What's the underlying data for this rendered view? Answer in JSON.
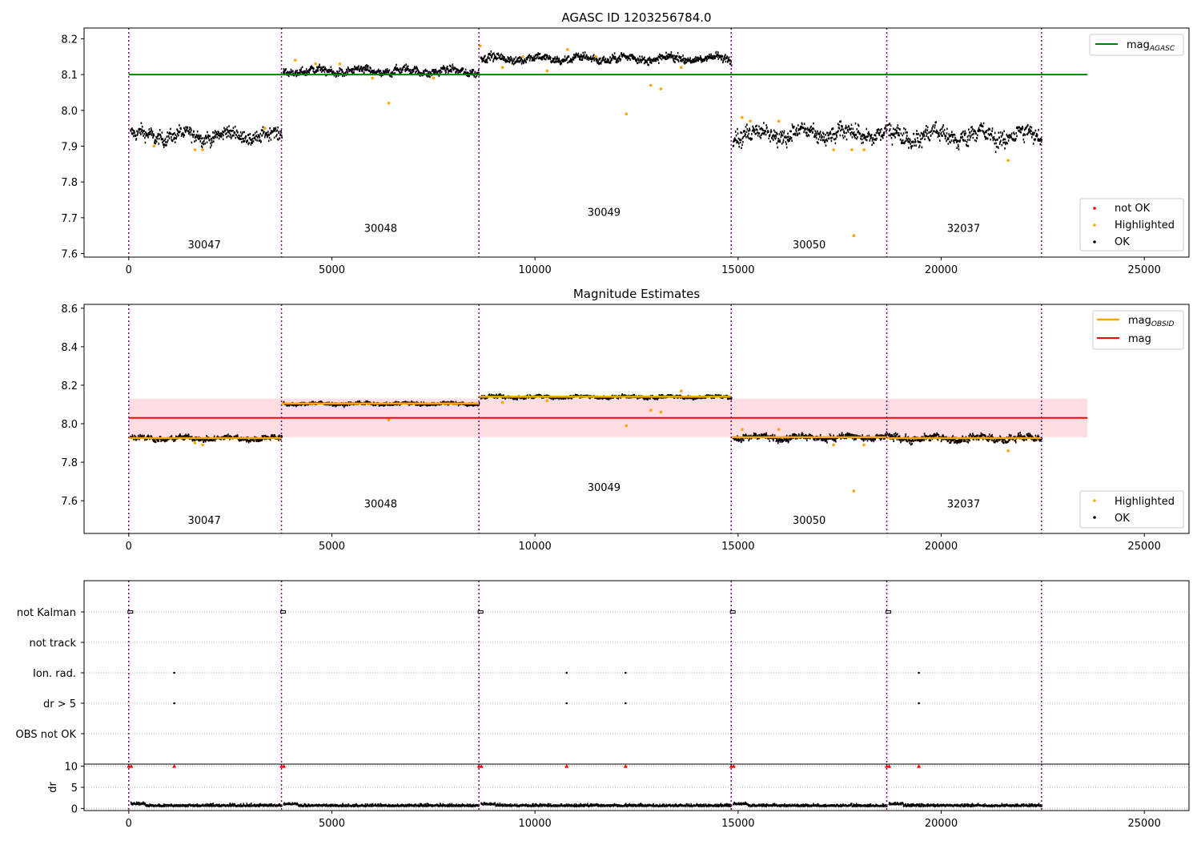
{
  "colors": {
    "ok": "#000000",
    "highlighted": "#ffa500",
    "not_ok": "#ff0000",
    "mag_agasc": "#008000",
    "mag": "#ff0000",
    "mag_band": "#ffb6c1",
    "obs_boundary": "#800080",
    "grid": "#b0b0b0"
  },
  "chart_data": [
    {
      "type": "scatter",
      "title": "AGASC ID 1203256784.0",
      "xlim": [
        -1100,
        26100
      ],
      "ylim": [
        7.59,
        8.23
      ],
      "xticks": [
        0,
        5000,
        10000,
        15000,
        20000,
        25000
      ],
      "yticks": [
        7.6,
        7.7,
        7.8,
        7.9,
        8.0,
        8.1,
        8.2
      ],
      "obs_boundaries": [
        0,
        3760,
        8620,
        14830,
        18660,
        22470
      ],
      "observations": [
        {
          "label": "30047",
          "x_start": 0,
          "x_end": 3760,
          "mag": 7.93,
          "spread": 0.02,
          "label_x": 1860,
          "label_y": 7.615
        },
        {
          "label": "30048",
          "x_start": 3760,
          "x_end": 8620,
          "mag": 8.11,
          "spread": 0.012,
          "label_x": 6200,
          "label_y": 7.66
        },
        {
          "label": "30049",
          "x_start": 8620,
          "x_end": 14830,
          "mag": 8.145,
          "spread": 0.012,
          "label_x": 11700,
          "label_y": 7.705
        },
        {
          "label": "30050",
          "x_start": 14830,
          "x_end": 18660,
          "mag": 7.935,
          "spread": 0.025,
          "label_x": 16750,
          "label_y": 7.615
        },
        {
          "label": "32037",
          "x_start": 18660,
          "x_end": 22470,
          "mag": 7.93,
          "spread": 0.027,
          "label_x": 20550,
          "label_y": 7.66
        }
      ],
      "highlighted": [
        [
          620,
          7.9
        ],
        [
          1630,
          7.89
        ],
        [
          1820,
          7.89
        ],
        [
          3350,
          7.95
        ],
        [
          4600,
          8.13
        ],
        [
          5200,
          8.13
        ],
        [
          6400,
          8.02
        ],
        [
          6000,
          8.09
        ],
        [
          7500,
          8.09
        ],
        [
          8650,
          8.18
        ],
        [
          9200,
          8.12
        ],
        [
          10300,
          8.11
        ],
        [
          10800,
          8.17
        ],
        [
          12250,
          7.99
        ],
        [
          12850,
          8.07
        ],
        [
          13100,
          8.06
        ],
        [
          13600,
          8.12
        ],
        [
          11500,
          8.15
        ],
        [
          15100,
          7.98
        ],
        [
          15300,
          7.97
        ],
        [
          17350,
          7.89
        ],
        [
          17800,
          7.89
        ],
        [
          18100,
          7.89
        ],
        [
          17850,
          7.65
        ],
        [
          21650,
          7.86
        ],
        [
          16000,
          7.97
        ],
        [
          4100,
          8.14
        ],
        [
          9700,
          8.15
        ]
      ],
      "hlines": [
        {
          "name": "mag_AGASC",
          "y": 8.1
        }
      ],
      "legend": {
        "upper": [
          "mag_AGASC"
        ],
        "lower": [
          "not OK",
          "Highlighted",
          "OK"
        ]
      }
    },
    {
      "type": "scatter",
      "title": "Magnitude Estimates",
      "xlim": [
        -1100,
        26100
      ],
      "ylim": [
        7.43,
        8.62
      ],
      "xticks": [
        0,
        5000,
        10000,
        15000,
        20000,
        25000
      ],
      "yticks": [
        7.6,
        7.8,
        8.0,
        8.2,
        8.4,
        8.6
      ],
      "obs_boundaries": [
        0,
        3760,
        8620,
        14830,
        18660,
        22470
      ],
      "mag": {
        "value": 8.03,
        "band": [
          7.93,
          8.13
        ]
      },
      "obs_labels": [
        {
          "label": "30047",
          "x": 1860,
          "y": 7.48
        },
        {
          "label": "30048",
          "x": 6200,
          "y": 7.565
        },
        {
          "label": "30049",
          "x": 11700,
          "y": 7.65
        },
        {
          "label": "30050",
          "x": 16750,
          "y": 7.48
        },
        {
          "label": "32037",
          "x": 20550,
          "y": 7.565
        }
      ],
      "highlighted": [
        [
          1630,
          7.9
        ],
        [
          1820,
          7.89
        ],
        [
          6400,
          8.02
        ],
        [
          12250,
          7.99
        ],
        [
          12850,
          8.07
        ],
        [
          13100,
          8.06
        ],
        [
          9200,
          8.11
        ],
        [
          10300,
          8.12
        ],
        [
          13600,
          8.17
        ],
        [
          17350,
          7.89
        ],
        [
          18100,
          7.89
        ],
        [
          17850,
          7.65
        ],
        [
          21650,
          7.86
        ],
        [
          15100,
          7.97
        ],
        [
          16000,
          7.97
        ]
      ],
      "legend": {
        "upper": [
          "mag_OBSID",
          "mag"
        ],
        "lower": [
          "Highlighted",
          "OK"
        ]
      }
    },
    {
      "type": "scatter",
      "title": "",
      "xlim": [
        -1100,
        26100
      ],
      "xticks": [
        0,
        5000,
        10000,
        15000,
        20000,
        25000
      ],
      "obs_boundaries": [
        0,
        3760,
        8620,
        14830,
        18660,
        22470
      ],
      "flags": [
        "not Kalman",
        "not track",
        "Ion. rad.",
        "dr > 5",
        "OBS not OK"
      ],
      "flag_points": {
        "not Kalman": [
          0,
          3760,
          8620,
          14830,
          18660
        ],
        "not track": [],
        "Ion. rad.": [
          1120,
          10780,
          12230,
          19450
        ],
        "dr > 5": [
          1120,
          10780,
          12230,
          19450
        ],
        "OBS not OK": []
      }
    },
    {
      "type": "scatter",
      "title": "",
      "ylabel": "dr",
      "xlim": [
        -1100,
        26100
      ],
      "ylim": [
        -0.5,
        10.5
      ],
      "xticks": [
        0,
        5000,
        10000,
        15000,
        20000,
        25000
      ],
      "yticks": [
        0,
        5,
        10
      ],
      "obs_boundaries": [
        0,
        3760,
        8620,
        14830,
        18660,
        22470
      ],
      "not_ok_x": [
        0,
        60,
        3760,
        3820,
        8620,
        8680,
        14830,
        14890,
        18660,
        18720,
        1120,
        10780,
        12230,
        19450
      ]
    }
  ]
}
